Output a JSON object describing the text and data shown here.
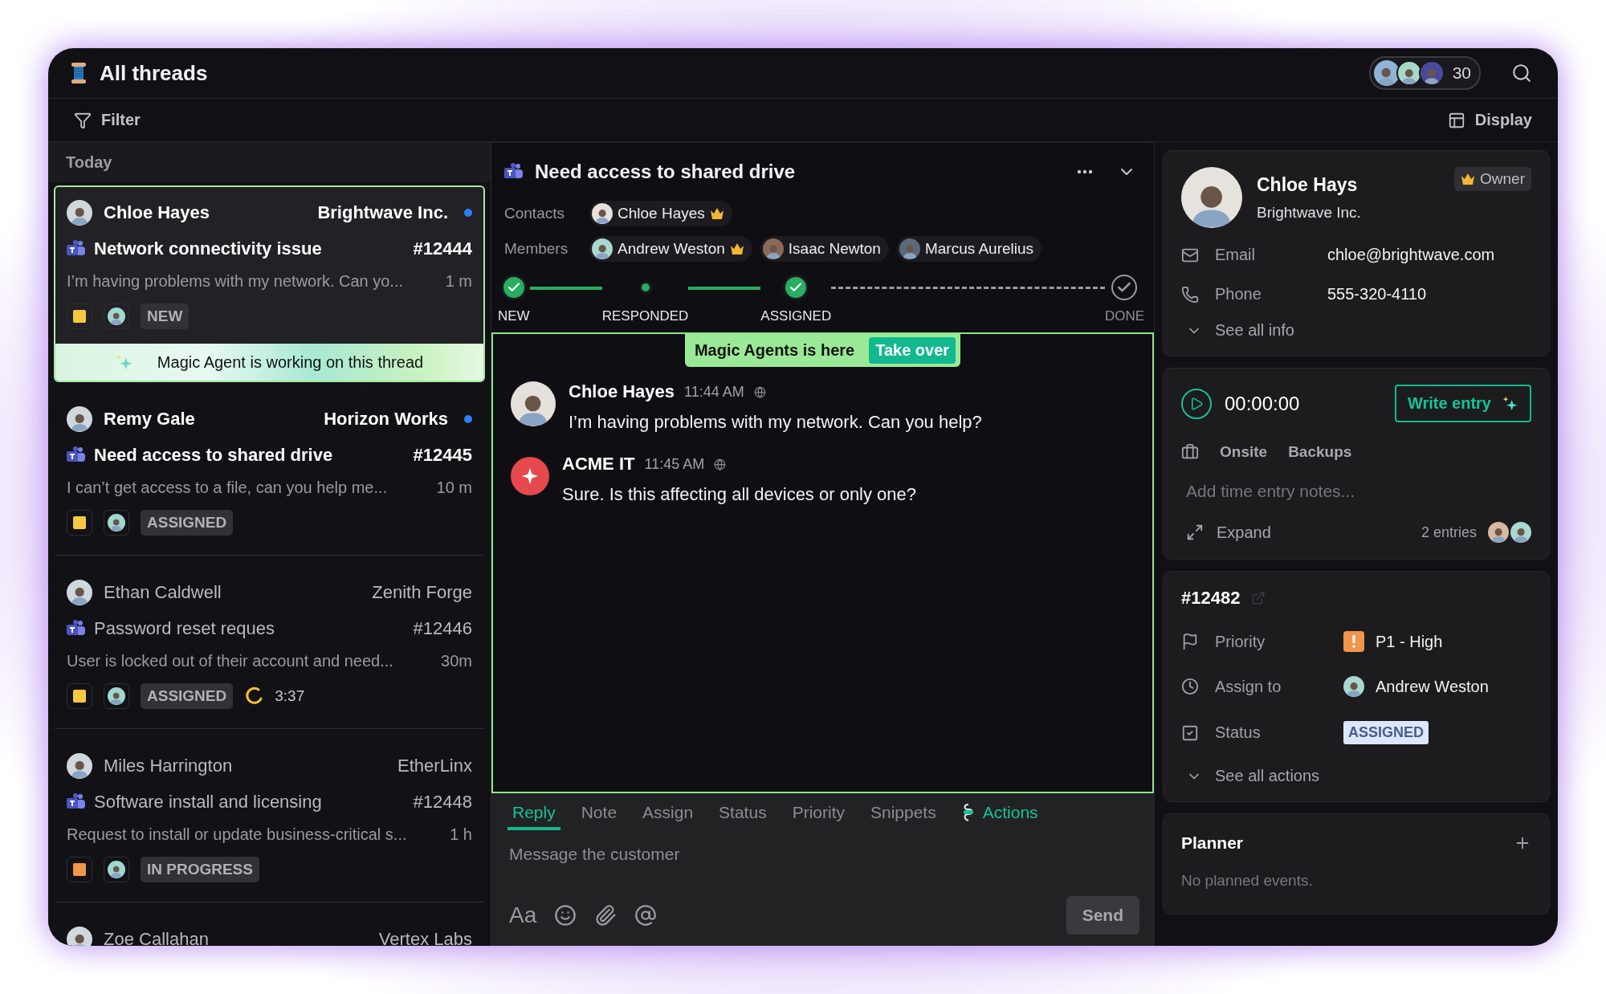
{
  "header": {
    "title": "All threads",
    "viewer_count": "30"
  },
  "toolbar": {
    "filter": "Filter",
    "display": "Display"
  },
  "list": {
    "section": "Today",
    "threads": [
      {
        "name": "Chloe Hayes",
        "company": "Brightwave Inc.",
        "unread": true,
        "selected": true,
        "title": "Network connectivity issue",
        "ticket": "#12444",
        "preview": "I’m having problems with my network. Can yo...",
        "time": "1 m",
        "color": "#f5c842",
        "status": "NEW",
        "agent_note": "Magic Agent is working on this thread"
      },
      {
        "name": "Remy Gale",
        "company": "Horizon Works",
        "unread": true,
        "selected": false,
        "title": "Need access to shared drive",
        "ticket": "#12445",
        "preview": "I can’t get access to a file, can you help me...",
        "time": "10 m",
        "color": "#f5c842",
        "status": "ASSIGNED"
      },
      {
        "name": "Ethan Caldwell",
        "company": "Zenith Forge",
        "unread": false,
        "selected": false,
        "title": "Password reset reques",
        "ticket": "#12446",
        "preview": "User is locked out of their account and need...",
        "time": "30m",
        "color": "#f5c842",
        "status": "ASSIGNED",
        "timer": "3:37"
      },
      {
        "name": "Miles Harrington",
        "company": "EtherLinx",
        "unread": false,
        "selected": false,
        "title": "Software install and licensing",
        "ticket": "#12448",
        "preview": "Request to install or update business-critical s...",
        "time": "1 h",
        "color": "#f0954a",
        "status": "IN PROGRESS"
      },
      {
        "name": "Zoe Callahan",
        "company": "Vertex Labs",
        "unread": false,
        "selected": false
      }
    ]
  },
  "conversation": {
    "title": "Need access to shared drive",
    "contacts_label": "Contacts",
    "contacts": [
      {
        "name": "Chloe Hayes",
        "owner": true
      }
    ],
    "members_label": "Members",
    "members": [
      {
        "name": "Andrew Weston",
        "owner": true
      },
      {
        "name": "Isaac Newton",
        "owner": false
      },
      {
        "name": "Marcus Aurelius",
        "owner": false
      }
    ],
    "steps": [
      {
        "label": "NEW",
        "kind": "check",
        "done": true
      },
      {
        "label": "RESPONDED",
        "kind": "dot",
        "done": true
      },
      {
        "label": "ASSIGNED",
        "kind": "check",
        "done": true
      },
      {
        "label": "DONE",
        "kind": "check",
        "done": false
      }
    ],
    "banner": {
      "text": "Magic Agents is here",
      "action": "Take over"
    },
    "messages": [
      {
        "kind": "person",
        "author": "Chloe Hayes",
        "time": "11:44 AM",
        "text": "I’m having problems with my network. Can you help?"
      },
      {
        "kind": "bot",
        "author": "ACME IT",
        "time": "11:45 AM",
        "text": "Sure. Is this affecting all devices or only one?"
      }
    ]
  },
  "composer": {
    "tabs": [
      {
        "label": "Reply",
        "kind": "tab",
        "selected": true
      },
      {
        "label": "Note",
        "kind": "tab",
        "selected": false
      },
      {
        "label": "Assign",
        "kind": "tab",
        "selected": false
      },
      {
        "label": "Status",
        "kind": "tab",
        "selected": false
      },
      {
        "label": "Priority",
        "kind": "tab",
        "selected": false
      },
      {
        "label": "Snippets",
        "kind": "tab",
        "selected": false
      },
      {
        "label": "Actions",
        "kind": "action",
        "selected": false
      }
    ],
    "placeholder": "Message the customer",
    "format": "Aa",
    "send": "Send"
  },
  "contact": {
    "name": "Chloe Hays",
    "company": "Brightwave Inc.",
    "role": "Owner",
    "fields": [
      {
        "kind": "email",
        "label": "Email",
        "value": "chloe@brightwave.com"
      },
      {
        "kind": "phone",
        "label": "Phone",
        "value": "555-320-4110"
      }
    ],
    "more": "See all info"
  },
  "time_entry": {
    "time": "00:00:00",
    "action": "Write entry",
    "tags": [
      "Onsite",
      "Backups"
    ],
    "placeholder": "Add time entry notes...",
    "expand": "Expand",
    "entries": "2 entries"
  },
  "ticket": {
    "number": "#12482",
    "rows": [
      {
        "kind": "priority",
        "label": "Priority",
        "value": "P1 - High"
      },
      {
        "kind": "assignee",
        "label": "Assign to",
        "value": "Andrew Weston"
      },
      {
        "kind": "status",
        "label": "Status",
        "value": "ASSIGNED"
      }
    ],
    "more": "See all actions"
  },
  "planner": {
    "title": "Planner",
    "empty": "No planned events."
  }
}
